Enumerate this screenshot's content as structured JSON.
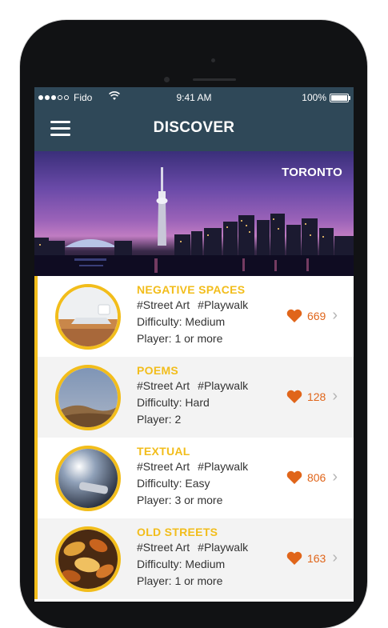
{
  "status_bar": {
    "carrier": "Fido",
    "time": "9:41 AM",
    "battery": "100%"
  },
  "nav": {
    "title": "DISCOVER"
  },
  "hero": {
    "label": "TORONTO"
  },
  "colors": {
    "nav_bg": "#2f4858",
    "accent": "#f2bd1b",
    "like": "#e0651a"
  },
  "items": [
    {
      "title": "NEGATIVE SPACES",
      "tag1": "#Street Art",
      "tag2": "#Playwalk",
      "difficulty": "Difficulty: Medium",
      "player": "Player: 1 or more",
      "likes": "669",
      "icon": "laptop-desk-photo"
    },
    {
      "title": "POEMS",
      "tag1": "#Street Art",
      "tag2": "#Playwalk",
      "difficulty": "Difficulty: Hard",
      "player": "Player: 2",
      "likes": "128",
      "icon": "desert-dune-photo"
    },
    {
      "title": "TEXTUAL",
      "tag1": "#Street Art",
      "tag2": "#Playwalk",
      "difficulty": "Difficulty: Easy",
      "player": "Player: 3 or more",
      "likes": "806",
      "icon": "phone-bokeh-photo"
    },
    {
      "title": "OLD STREETS",
      "tag1": "#Street Art",
      "tag2": "#Playwalk",
      "difficulty": "Difficulty: Medium",
      "player": "Player: 1 or more",
      "likes": "163",
      "icon": "autumn-leaves-photo"
    }
  ]
}
